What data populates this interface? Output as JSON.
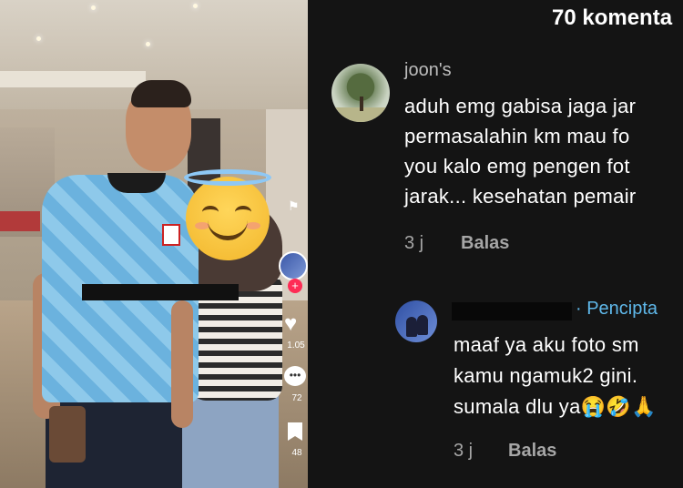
{
  "header": {
    "comment_count": "70 komenta"
  },
  "video": {
    "sidebar": {
      "likes": "1.05",
      "comments": "72",
      "saves": "48"
    }
  },
  "comments": [
    {
      "username": "joon's",
      "lines": [
        "aduh emg gabisa jaga jar",
        "permasalahin km mau fo",
        "you kalo emg pengen fot",
        "jarak... kesehatan pemair"
      ],
      "time": "3 j",
      "reply_label": "Balas"
    },
    {
      "username_hidden": true,
      "badge": "· Pencipta",
      "lines": [
        "maaf ya aku foto sm",
        "kamu ngamuk2 gini.",
        "sumala dlu ya😭🤣🙏"
      ],
      "time": "3 j",
      "reply_label": "Balas"
    }
  ],
  "colors": {
    "creator_badge": "#5fb8ea",
    "background": "#141414",
    "tiktok_red": "#fe2c55"
  }
}
